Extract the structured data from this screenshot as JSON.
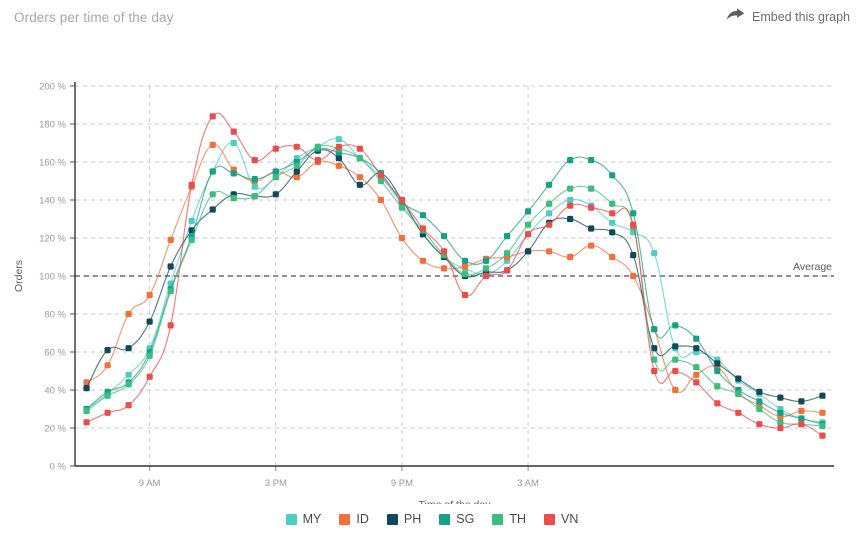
{
  "header": {
    "title": "Orders per time of the day",
    "embed_label": "Embed this graph",
    "embed_icon": "share-arrow-icon"
  },
  "legend": {
    "position": "bottom",
    "items": [
      {
        "label": "MY",
        "color": "#4ECDC4"
      },
      {
        "label": "ID",
        "color": "#F2703A"
      },
      {
        "label": "PH",
        "color": "#11485C"
      },
      {
        "label": "SG",
        "color": "#16A085"
      },
      {
        "label": "TH",
        "color": "#3BBE7C"
      },
      {
        "label": "VN",
        "color": "#EE4B4B"
      }
    ]
  },
  "annotations": {
    "average_label": "Average",
    "average_value": 100
  },
  "chart_data": {
    "type": "line",
    "title": "Orders per time of the day",
    "xlabel": "Time of the day",
    "ylabel": "Orders",
    "ylim": [
      0,
      200
    ],
    "ytick_step": 20,
    "ytick_suffix": " %",
    "yticks": [
      0,
      20,
      40,
      60,
      80,
      100,
      120,
      140,
      160,
      180,
      200
    ],
    "ytick_labels": [
      "0 %",
      "20 %",
      "40 %",
      "60 %",
      "80 %",
      "100 %",
      "120 %",
      "140 %",
      "160 %",
      "180 %",
      "200 %"
    ],
    "grid": true,
    "legend_position": "bottom",
    "x": [
      6,
      7,
      8,
      9,
      10,
      11,
      12,
      13,
      14,
      15,
      16,
      17,
      18,
      19,
      20,
      21,
      22,
      23,
      24,
      25,
      26,
      27,
      28,
      29,
      30,
      31,
      32,
      33,
      34,
      35,
      36,
      37
    ],
    "xticks": [
      9,
      15,
      21,
      27
    ],
    "xtick_labels": [
      "9 AM",
      "3 PM",
      "9 PM",
      "3 AM"
    ],
    "series": [
      {
        "name": "MY",
        "color": "#4ECDC4",
        "values": [
          30,
          38,
          48,
          62,
          96,
          129,
          155,
          170,
          147,
          152,
          162,
          168,
          172,
          162,
          152,
          138,
          122,
          110,
          104,
          101,
          108,
          122,
          133,
          140,
          137,
          128,
          123,
          112,
          62,
          60,
          56,
          45,
          38,
          30,
          25,
          23
        ]
      },
      {
        "name": "ID",
        "color": "#F2703A",
        "values": [
          44,
          53,
          80,
          90,
          119,
          147,
          169,
          156,
          150,
          155,
          152,
          160,
          158,
          152,
          140,
          120,
          108,
          104,
          105,
          109,
          110,
          113,
          113,
          110,
          116,
          110,
          100,
          72,
          40,
          48,
          52,
          38,
          32,
          26,
          29,
          28
        ]
      },
      {
        "name": "PH",
        "color": "#11485C",
        "values": [
          41,
          61,
          62,
          76,
          105,
          124,
          135,
          143,
          142,
          143,
          155,
          166,
          162,
          148,
          154,
          140,
          122,
          110,
          100,
          102,
          103,
          113,
          128,
          130,
          125,
          123,
          111,
          62,
          63,
          62,
          54,
          46,
          39,
          36,
          34,
          37
        ]
      },
      {
        "name": "SG",
        "color": "#16A085",
        "values": [
          30,
          39,
          44,
          60,
          93,
          121,
          155,
          154,
          151,
          155,
          160,
          167,
          165,
          162,
          154,
          139,
          132,
          121,
          108,
          108,
          121,
          134,
          148,
          161,
          161,
          153,
          133,
          72,
          74,
          67,
          50,
          40,
          34,
          28,
          25,
          22
        ]
      },
      {
        "name": "TH",
        "color": "#3BBE7C",
        "values": [
          29,
          37,
          43,
          58,
          92,
          119,
          143,
          141,
          142,
          152,
          158,
          168,
          167,
          162,
          150,
          136,
          124,
          111,
          101,
          104,
          112,
          127,
          138,
          146,
          146,
          138,
          126,
          56,
          56,
          52,
          42,
          38,
          30,
          23,
          22,
          21
        ]
      },
      {
        "name": "VN",
        "color": "#EE4B4B",
        "values": [
          23,
          28,
          32,
          47,
          74,
          148,
          184,
          176,
          161,
          167,
          168,
          161,
          168,
          167,
          153,
          140,
          125,
          113,
          90,
          100,
          103,
          122,
          127,
          137,
          136,
          133,
          127,
          50,
          50,
          44,
          33,
          28,
          22,
          20,
          22,
          16
        ]
      }
    ]
  }
}
